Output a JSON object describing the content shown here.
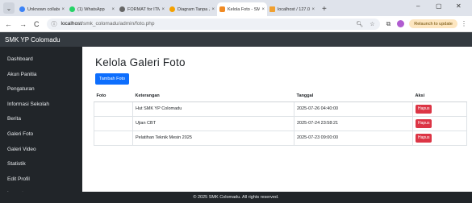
{
  "browser": {
    "tabs": [
      {
        "label": "Unknown collabo",
        "color": "#3b82f6",
        "active": false
      },
      {
        "label": "(1) WhatsApp",
        "color": "#25d366",
        "active": false
      },
      {
        "label": "FORMAT for ITM",
        "color": "#666666",
        "active": false
      },
      {
        "label": "Diagram Tanpa Ju",
        "color": "#f4a100",
        "active": false
      },
      {
        "label": "Kelola Foto - SMK",
        "color": "#f08a24",
        "active": true
      },
      {
        "label": "localhost / 127.0.",
        "color": "#f0a030",
        "active": false
      }
    ],
    "tab_close": "×",
    "new_tab": "+",
    "win_min": "–",
    "win_max": "▢",
    "win_close": "✕",
    "menu_glyph": "⌄",
    "back": "←",
    "forward": "→",
    "reload": "C",
    "url_host": "localhost",
    "url_path": "/smk_colomadu/admin/foto.php",
    "relaunch_label": "Relaunch to update"
  },
  "app": {
    "brand": "SMK YP Colomadu",
    "sidebar": [
      "Dashboard",
      "Akun Panitia",
      "Pengaturan",
      "Informasi Sekolah",
      "Berita",
      "Galeri Foto",
      "Galeri Video",
      "Statistik",
      "Edit Profil",
      "Logout"
    ],
    "page_title": "Kelola Galeri Foto",
    "add_button": "Tambah Foto",
    "table": {
      "headers": [
        "Foto",
        "Keterangan",
        "Tanggal",
        "Aksi"
      ],
      "rows": [
        {
          "keterangan": "Hut SMK YP Colomadu",
          "tanggal": "2025-07-26 04:40:00",
          "aksi": "Hapus"
        },
        {
          "keterangan": "Ujian CBT",
          "tanggal": "2025-07-24 23:58:21",
          "aksi": "Hapus"
        },
        {
          "keterangan": "Pelatihan Teknik Mesin 2025",
          "tanggal": "2025-07-23 09:00:00",
          "aksi": "Hapus"
        }
      ]
    },
    "footer": "© 2025 SMK Colomadu. All rights reserved."
  }
}
